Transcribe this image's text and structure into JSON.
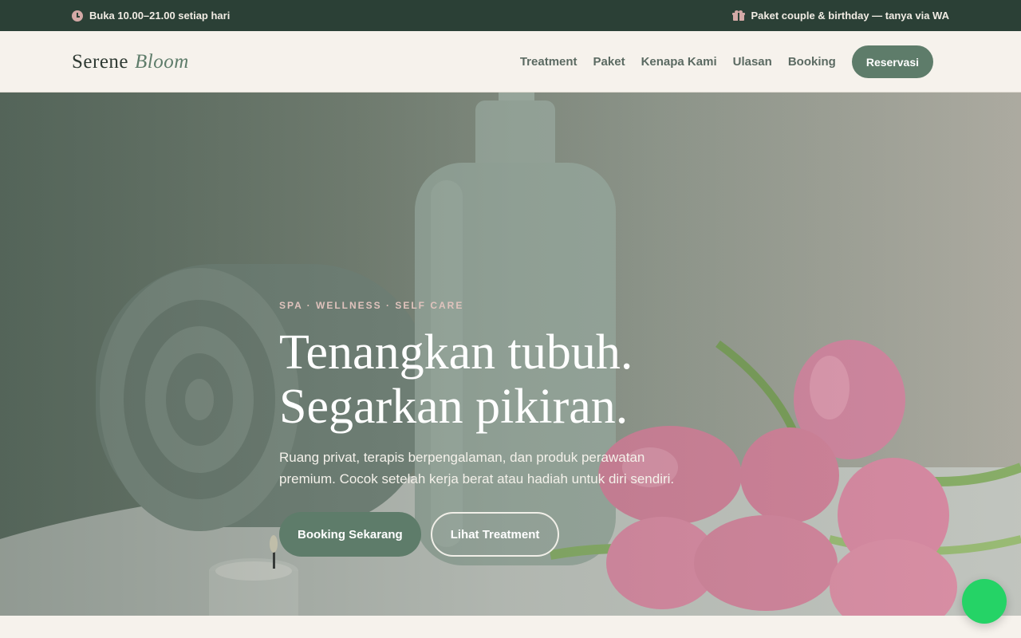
{
  "topbar": {
    "hours": "Buka 10.00–21.00 setiap hari",
    "promo": "Paket couple & birthday — tanya via WA"
  },
  "header": {
    "brand_main": "Serene",
    "brand_accent": "Bloom",
    "nav": [
      "Treatment",
      "Paket",
      "Kenapa Kami",
      "Ulasan",
      "Booking"
    ],
    "cta": "Reservasi"
  },
  "hero": {
    "eyebrow": "SPA · WELLNESS · SELF CARE",
    "headline_line1": "Tenangkan tubuh.",
    "headline_line2": "Segarkan pikiran.",
    "subtitle": "Ruang privat, terapis berpengalaman, dan produk perawatan premium. Cocok setelah kerja berat atau hadiah untuk diri sendiri.",
    "primary_button": "Booking Sekarang",
    "secondary_button": "Lihat Treatment"
  },
  "colors": {
    "topbar_bg": "#2b4036",
    "accent": "#5e7c6a",
    "eyebrow": "#e0c3bd",
    "whatsapp": "#25d366"
  },
  "icons": [
    "clock-icon",
    "gift-icon",
    "whatsapp-icon"
  ]
}
